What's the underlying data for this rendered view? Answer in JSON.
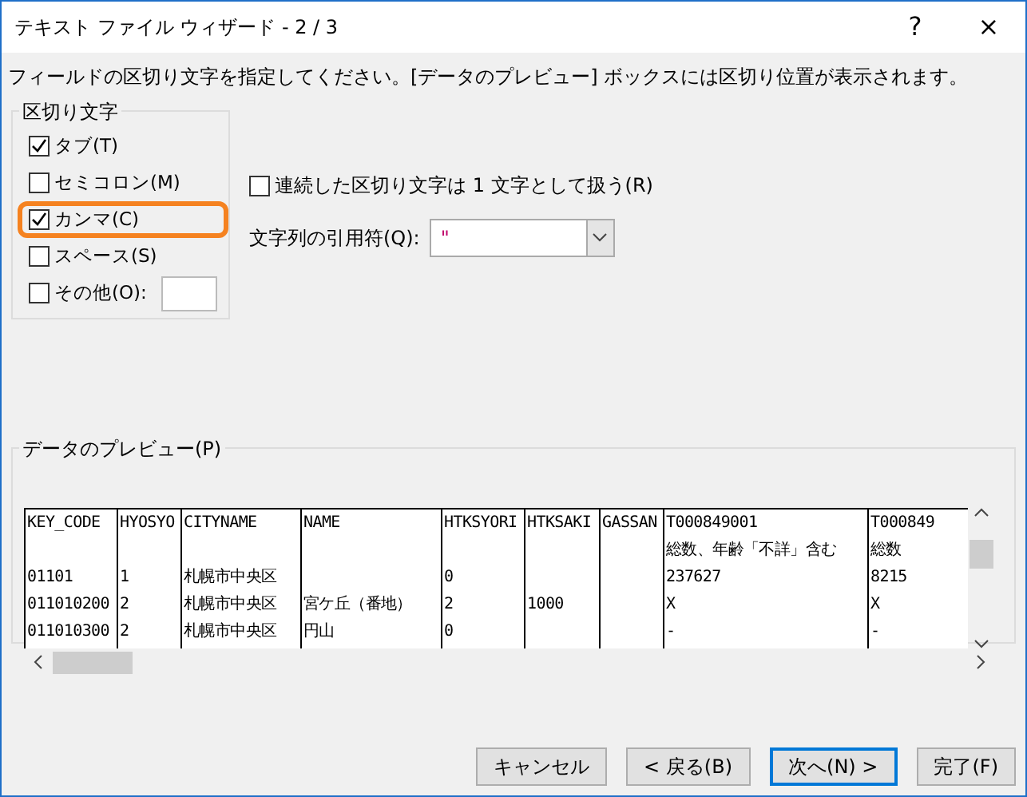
{
  "window": {
    "title": "テキスト ファイル ウィザード - 2 / 3",
    "help": "?",
    "close": "×"
  },
  "instruction": "フィールドの区切り文字を指定してください。[データのプレビュー] ボックスには区切り位置が表示されます。",
  "delimiters": {
    "title": "区切り文字",
    "items": [
      {
        "label": "タブ(T)",
        "checked": true,
        "highlighted": false
      },
      {
        "label": "セミコロン(M)",
        "checked": false,
        "highlighted": false
      },
      {
        "label": "カンマ(C)",
        "checked": true,
        "highlighted": true
      },
      {
        "label": "スペース(S)",
        "checked": false,
        "highlighted": false
      },
      {
        "label": "その他(O):",
        "checked": false,
        "highlighted": false,
        "kind": "other"
      }
    ]
  },
  "consecutive": {
    "label": "連続した区切り文字は 1 文字として扱う(R)",
    "checked": false
  },
  "qualifier": {
    "label": "文字列の引用符(Q):",
    "value": "\""
  },
  "preview": {
    "title": "データのプレビュー(P)",
    "columns": [
      [
        "KEY_CODE",
        "",
        "01101",
        "011010200",
        "011010300"
      ],
      [
        "HYOSYO",
        "",
        "1",
        "2",
        "2"
      ],
      [
        "CITYNAME",
        "",
        "札幌市中央区",
        "札幌市中央区",
        "札幌市中央区"
      ],
      [
        "NAME",
        "",
        "",
        "宮ケ丘（番地）",
        "円山"
      ],
      [
        "HTKSYORI",
        "",
        "0",
        "2",
        "0"
      ],
      [
        "HTKSAKI",
        "",
        "",
        "1000",
        ""
      ],
      [
        "GASSAN",
        "",
        "",
        "",
        ""
      ],
      [
        "T000849001",
        "総数、年齢「不詳」含む",
        "237627",
        "X",
        "-"
      ],
      [
        "T000849",
        "総数",
        "8215",
        "X",
        "-"
      ]
    ]
  },
  "buttons": [
    {
      "label": "キャンセル",
      "default": false
    },
    {
      "label": "< 戻る(B)",
      "default": false
    },
    {
      "label": "次へ(N) >",
      "default": true
    },
    {
      "label": "完了(F)",
      "default": false
    }
  ]
}
